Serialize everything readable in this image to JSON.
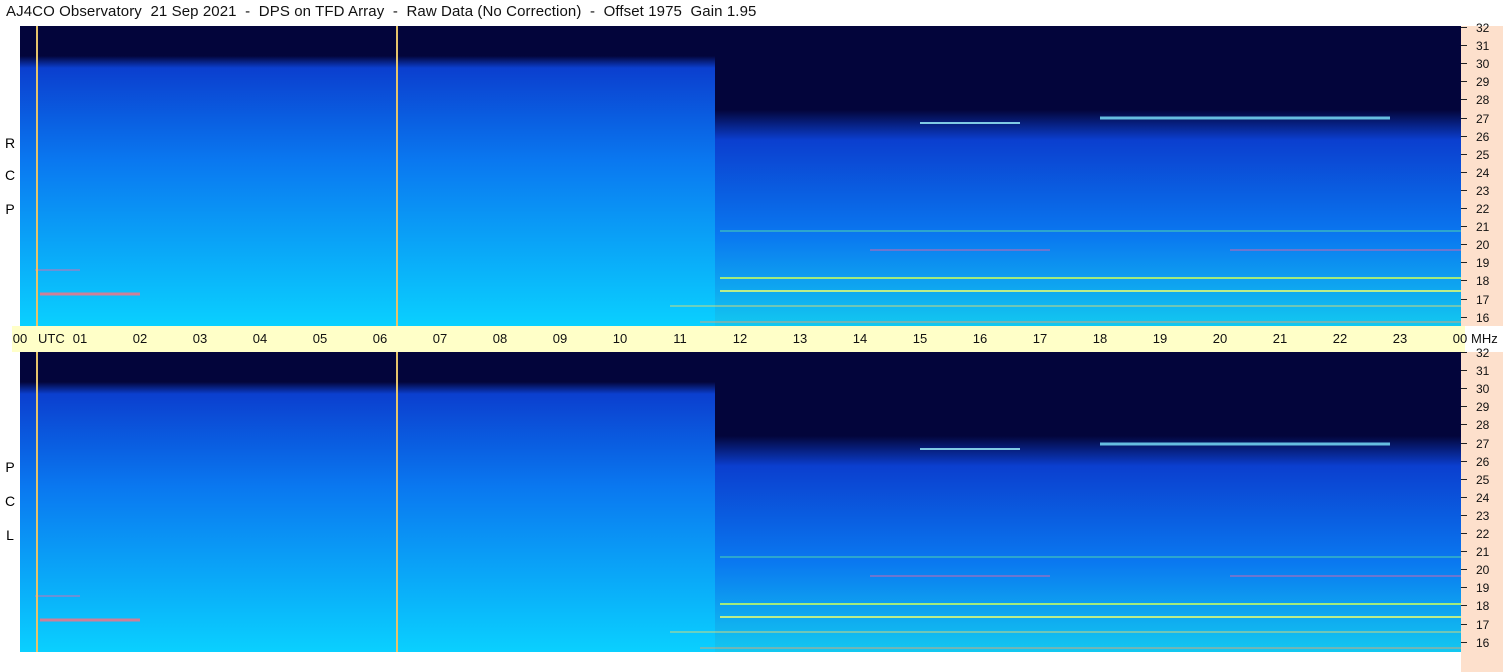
{
  "title": "AJ4CO Observatory  21 Sep 2021  -  DPS on TFD Array  -  Raw Data (No Correction)  -  Offset 1975  Gain 1.95",
  "panels": {
    "rcp": {
      "letters": [
        "R",
        "C",
        "P"
      ]
    },
    "lcp": {
      "letters": [
        "L",
        "C",
        "P"
      ]
    }
  },
  "time_axis": {
    "utc_label": "UTC",
    "unit_label": "MHz",
    "hours": [
      "00",
      "01",
      "02",
      "03",
      "04",
      "05",
      "06",
      "07",
      "08",
      "09",
      "10",
      "11",
      "12",
      "13",
      "14",
      "15",
      "16",
      "17",
      "18",
      "19",
      "20",
      "21",
      "22",
      "23",
      "00"
    ]
  },
  "freq_axis": {
    "labels": [
      "32",
      "31",
      "30",
      "29",
      "28",
      "27",
      "26",
      "25",
      "24",
      "23",
      "22",
      "21",
      "20",
      "19",
      "18",
      "17",
      "16"
    ]
  },
  "colors": {
    "night": "#03053b",
    "deep_blue": "#0b3fcf",
    "mid_blue": "#0a78f0",
    "cyan": "#0ad0ff",
    "marker_line": "#e6c46a",
    "axis_fill": "#ffffc8",
    "tick_fill": "#fde0cc"
  }
}
